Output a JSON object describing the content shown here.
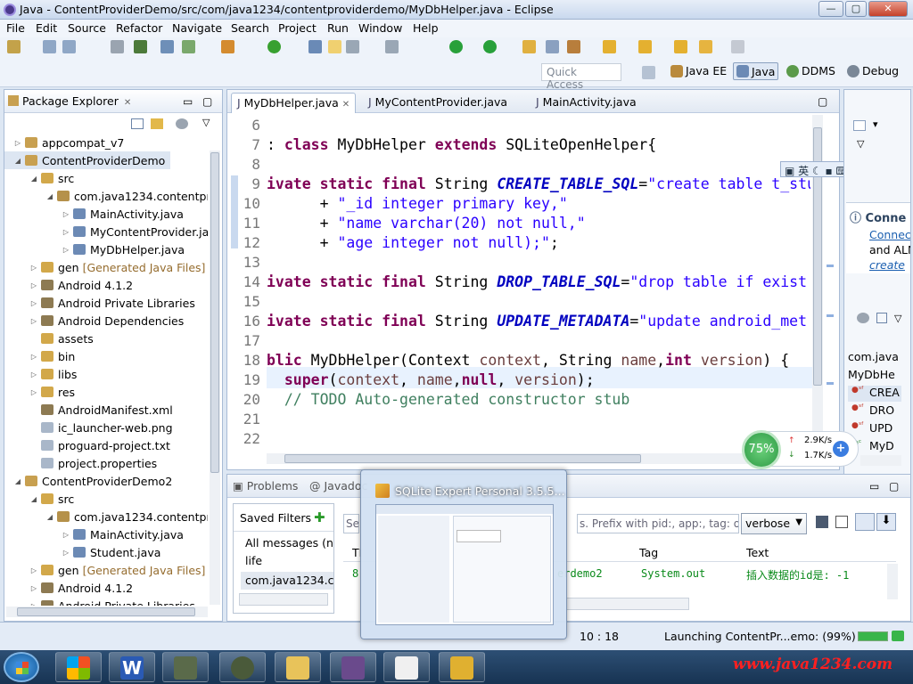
{
  "window": {
    "title": "Java - ContentProviderDemo/src/com/java1234/contentproviderdemo/MyDbHelper.java - Eclipse",
    "min": "—",
    "max": "▢",
    "close": "✕"
  },
  "menu": [
    "File",
    "Edit",
    "Source",
    "Refactor",
    "Navigate",
    "Search",
    "Project",
    "Run",
    "Window",
    "Help"
  ],
  "quick_access": "Quick Access",
  "perspectives": [
    {
      "label": "Java EE"
    },
    {
      "label": "Java",
      "active": true
    },
    {
      "label": "DDMS"
    },
    {
      "label": "Debug"
    }
  ],
  "package_explorer": {
    "title": "Package Explorer",
    "rows": [
      {
        "label": "appcompat_v7",
        "indent": 0,
        "twisty": "▷"
      },
      {
        "label": "ContentProviderDemo",
        "indent": 0,
        "twisty": "◢",
        "selected": true
      },
      {
        "label": "src",
        "indent": 1,
        "twisty": "◢"
      },
      {
        "label": "com.java1234.contentprc",
        "indent": 2,
        "twisty": "◢"
      },
      {
        "label": "MainActivity.java",
        "indent": 3,
        "twisty": "▷"
      },
      {
        "label": "MyContentProvider.ja",
        "indent": 3,
        "twisty": "▷"
      },
      {
        "label": "MyDbHelper.java",
        "indent": 3,
        "twisty": "▷"
      },
      {
        "label": "gen",
        "extra": "[Generated Java Files]",
        "indent": 1,
        "twisty": "▷"
      },
      {
        "label": "Android 4.1.2",
        "indent": 1,
        "twisty": "▷"
      },
      {
        "label": "Android Private Libraries",
        "indent": 1,
        "twisty": "▷"
      },
      {
        "label": "Android Dependencies",
        "indent": 1,
        "twisty": "▷"
      },
      {
        "label": "assets",
        "indent": 1,
        "twisty": ""
      },
      {
        "label": "bin",
        "indent": 1,
        "twisty": "▷"
      },
      {
        "label": "libs",
        "indent": 1,
        "twisty": "▷"
      },
      {
        "label": "res",
        "indent": 1,
        "twisty": "▷"
      },
      {
        "label": "AndroidManifest.xml",
        "indent": 1,
        "twisty": ""
      },
      {
        "label": "ic_launcher-web.png",
        "indent": 1,
        "twisty": ""
      },
      {
        "label": "proguard-project.txt",
        "indent": 1,
        "twisty": ""
      },
      {
        "label": "project.properties",
        "indent": 1,
        "twisty": ""
      },
      {
        "label": "ContentProviderDemo2",
        "indent": 0,
        "twisty": "◢"
      },
      {
        "label": "src",
        "indent": 1,
        "twisty": "◢"
      },
      {
        "label": "com.java1234.contentprc",
        "indent": 2,
        "twisty": "◢"
      },
      {
        "label": "MainActivity.java",
        "indent": 3,
        "twisty": "▷"
      },
      {
        "label": "Student.java",
        "indent": 3,
        "twisty": "▷"
      },
      {
        "label": "gen",
        "extra": "[Generated Java Files]",
        "indent": 1,
        "twisty": "▷"
      },
      {
        "label": "Android 4.1.2",
        "indent": 1,
        "twisty": "▷"
      },
      {
        "label": "Android Private Libraries",
        "indent": 1,
        "twisty": "▷"
      }
    ]
  },
  "editor": {
    "tabs": [
      {
        "label": "MyDbHelper.java",
        "active": true,
        "close": "✕"
      },
      {
        "label": "MyContentProvider.java"
      },
      {
        "label": "MainActivity.java"
      }
    ],
    "lines": [
      {
        "n": "6",
        "html": ""
      },
      {
        "n": "7",
        "html": "<span class='kw'>class</span> MyDbHelper <span class='kw'>extends</span> SQLiteOpenHelper{",
        "prefix": ": "
      },
      {
        "n": "8",
        "html": ""
      },
      {
        "n": "9",
        "html": "ivate static final String <span class='fld'>CREATE_TABLE_SQL</span>=<span class='str'>\"create table t_stu</span>"
      },
      {
        "n": "10",
        "html": "      + <span class='str'>\"_id integer primary key,\"</span>"
      },
      {
        "n": "11",
        "html": "      + <span class='str'>\"name varchar(20) not null,\"</span>"
      },
      {
        "n": "12",
        "html": "      + <span class='str'>\"age integer not null);\"</span>;"
      },
      {
        "n": "13",
        "html": ""
      },
      {
        "n": "14",
        "html": "ivate static final String <span class='fld'>DROP_TABLE_SQL</span>=<span class='str'>\"drop table if exist</span>"
      },
      {
        "n": "15",
        "html": ""
      },
      {
        "n": "16",
        "html": "ivate static final String <span class='fld'>UPDATE_METADATA</span>=<span class='str'>\"update android_met</span>"
      },
      {
        "n": "17",
        "html": ""
      },
      {
        "n": "18",
        "html": "blic MyDbHelper(Context <span class='prm'>context</span>, String <span class='prm'>name</span>,<span class='kw'>int</span> <span class='prm'>version</span>) {"
      },
      {
        "n": "19",
        "html": "  <span class='kw'>super</span>(<span class='prm'>context</span>, <span class='prm'>name</span>,<span class='kw'>null</span>, <span class='prm'>version</span>);"
      },
      {
        "n": "20",
        "html": "  <span class='cmt'>// TODO Auto-generated constructor stub</span>"
      },
      {
        "n": "21",
        "html": ""
      },
      {
        "n": "22",
        "html": ""
      }
    ]
  },
  "outline": {
    "title": "Conne",
    "link": "Connec",
    "text1": "and ALN",
    "link2": "create",
    "items": [
      "com.java",
      "MyDbHe",
      "CREA",
      "DRO",
      "UPD",
      "MyD"
    ]
  },
  "bottom": {
    "tabs": [
      "Problems",
      "Javadoc"
    ],
    "saved_filters": "Saved Filters",
    "filters": [
      "All messages (nc",
      "life",
      "com.java1234.co"
    ],
    "search_placeholder": "Se",
    "search_hint": "s. Prefix with pid:, app:, tag: or t",
    "level": "verbose",
    "columns": [
      "TI",
      "Tag",
      "Text"
    ],
    "row": {
      "app": "erdemo2",
      "tag": "System.out",
      "text": "插入数据的id是: -1",
      "col0": "8"
    }
  },
  "network": {
    "percent": "75%",
    "up": "2.9K/s",
    "down": "1.7K/s"
  },
  "popup": {
    "title": "SQLite Expert Personal 3.5.5..."
  },
  "status": {
    "position": "10 : 18",
    "launch": "Launching ContentPr...emo: (99%)"
  },
  "watermark": "www.java1234.com",
  "taskbar": {
    "items": [
      "start",
      "explorer",
      "word",
      "app1",
      "app2",
      "folder",
      "java-ee-ide",
      "app3",
      "sqlite"
    ]
  }
}
